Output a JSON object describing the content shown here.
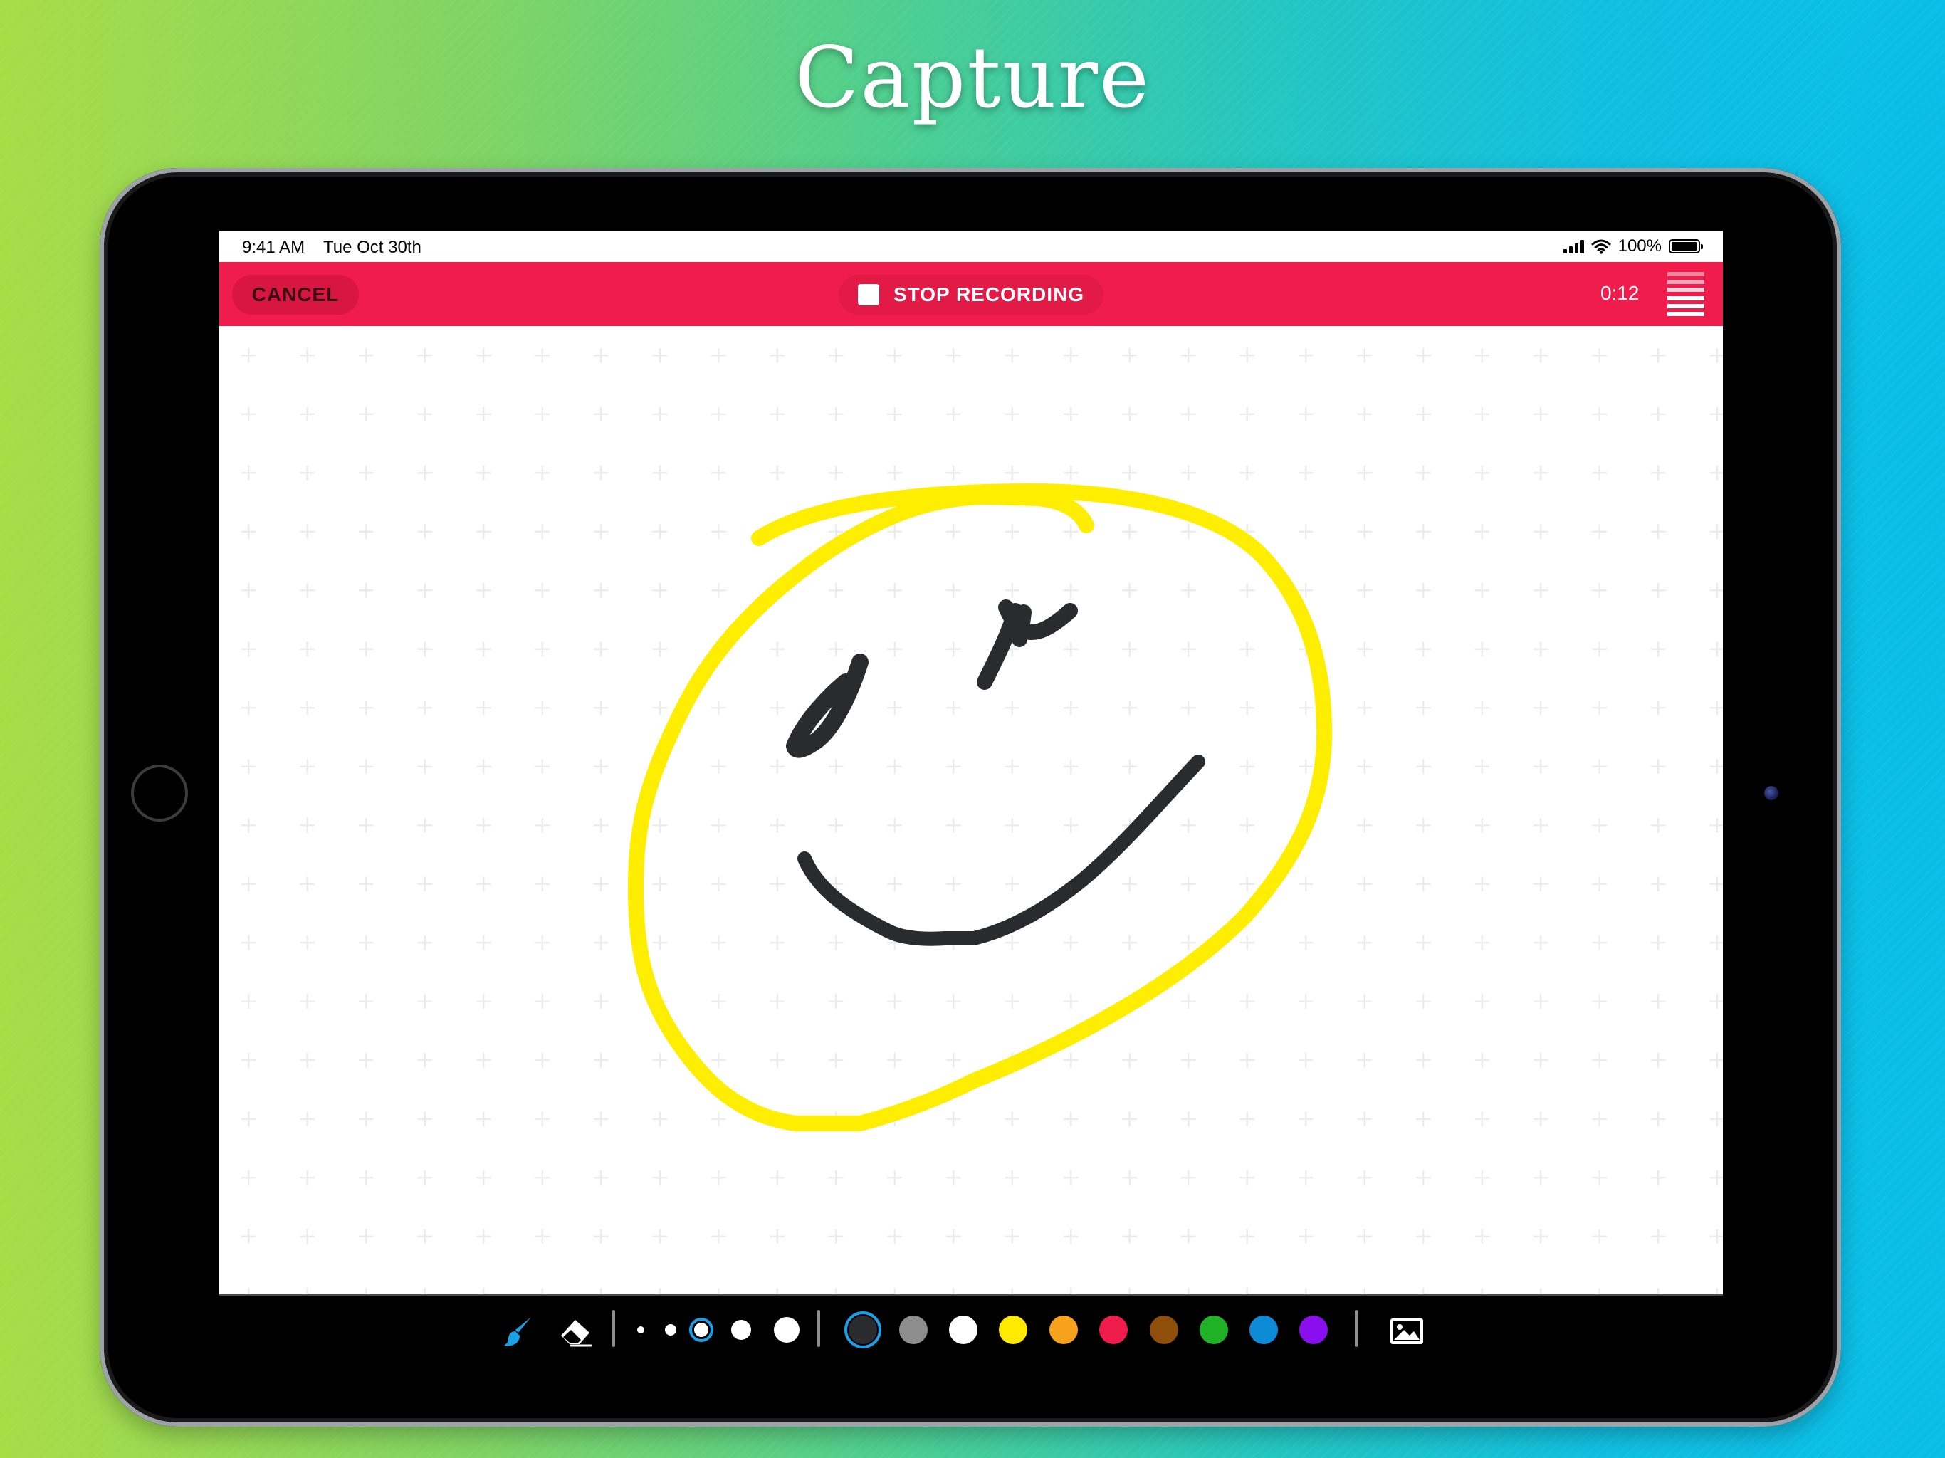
{
  "headline": "Capture",
  "status_bar": {
    "time": "9:41 AM",
    "date": "Tue Oct 30th",
    "battery": "100%"
  },
  "topbar": {
    "cancel_label": "CANCEL",
    "stop_label": "STOP RECORDING",
    "timer": "0:12"
  },
  "toolbar": {
    "tools": [
      "brush-icon",
      "eraser-icon"
    ],
    "brush_sizes": [
      "extra-small",
      "small",
      "medium",
      "large",
      "extra-large"
    ],
    "selected_brush_size": "medium",
    "colors": [
      "#2a2b2f",
      "#8d8d8d",
      "#ffffff",
      "#ffea00",
      "#f6a21d",
      "#f01c4c",
      "#8f4e0a",
      "#22b227",
      "#0e8bd7",
      "#8a0fef"
    ],
    "selected_color": "#2a2b2f",
    "image_tool": "image-icon"
  },
  "colors": {
    "accent_red": "#f01c4c",
    "selection_ring": "#1aa0e6",
    "drawing_yellow": "#ffee00",
    "drawing_dark": "#2a2b2f"
  }
}
